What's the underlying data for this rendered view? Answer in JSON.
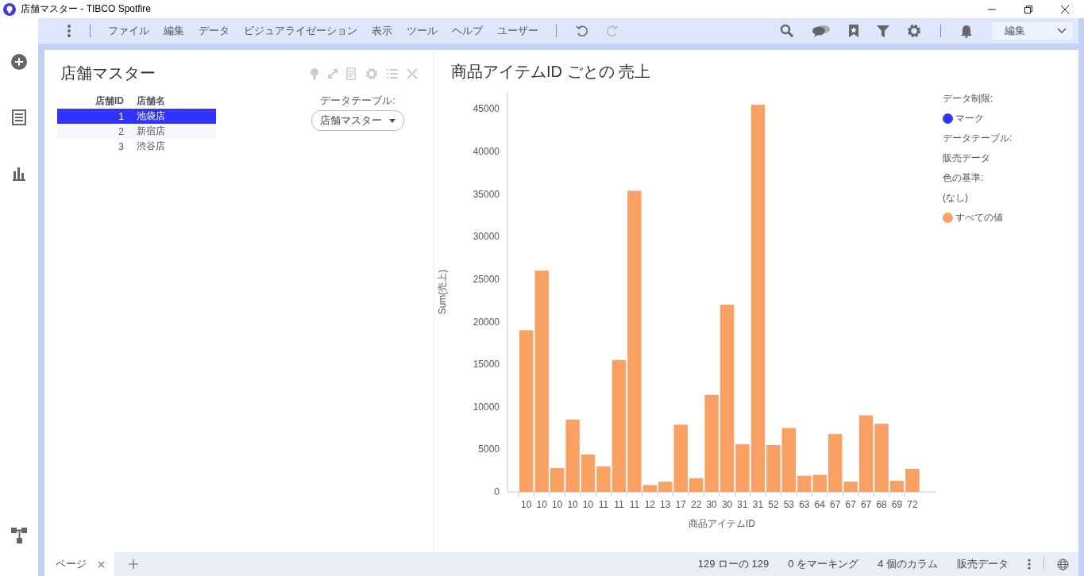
{
  "window": {
    "title": "店舗マスター - TIBCO Spotfire"
  },
  "menu": [
    "ファイル",
    "編集",
    "データ",
    "ビジュアライゼーション",
    "表示",
    "ツール",
    "ヘルプ",
    "ユーザー"
  ],
  "mode_dropdown": {
    "value": "編集"
  },
  "table_panel": {
    "title": "店舗マスター",
    "columns": [
      "店舗ID",
      "店舗名"
    ],
    "rows": [
      {
        "cells": [
          "1",
          "池袋店"
        ],
        "selected": true
      },
      {
        "cells": [
          "2",
          "新宿店"
        ],
        "selected": false
      },
      {
        "cells": [
          "3",
          "渋谷店"
        ],
        "selected": false
      }
    ],
    "data_table_label": "データテーブル:",
    "data_table_value": "店舗マスター"
  },
  "chart_panel": {
    "title": "商品アイテムID ごとの 売上",
    "chart_data": {
      "type": "bar",
      "xlabel": "商品アイテムID",
      "ylabel": "Sum(売上)",
      "categories": [
        "10",
        "10",
        "10",
        "10",
        "10",
        "11",
        "11",
        "11",
        "12",
        "13",
        "17",
        "22",
        "30",
        "30",
        "31",
        "31",
        "52",
        "53",
        "63",
        "64",
        "67",
        "67",
        "67",
        "68",
        "69",
        "72"
      ],
      "series": [
        {
          "name": "すべての値",
          "color": "#f9a062",
          "values": [
            19000,
            26000,
            2800,
            8500,
            4400,
            3000,
            15500,
            35400,
            800,
            1200,
            7900,
            1600,
            11400,
            22000,
            5600,
            45500,
            5500,
            7500,
            1900,
            2000,
            6800,
            1200,
            9000,
            8000,
            1300,
            2700
          ]
        }
      ],
      "ylim": [
        0,
        47000
      ],
      "yticks": [
        0,
        5000,
        10000,
        15000,
        20000,
        25000,
        30000,
        35000,
        40000,
        45000
      ]
    },
    "legend": [
      {
        "kind": "heading",
        "text": "データ制限:"
      },
      {
        "kind": "swatch",
        "text": "マーク",
        "color": "#3333ff"
      },
      {
        "kind": "heading",
        "text": "データテーブル:"
      },
      {
        "kind": "value",
        "text": "販売データ"
      },
      {
        "kind": "heading",
        "text": "色の基準:"
      },
      {
        "kind": "value",
        "text": "(なし)"
      }
    ]
  },
  "page_tab": {
    "label": "ページ"
  },
  "status_bar": [
    "129 ローの 129",
    "0 をマーキング",
    "4 個のカラム",
    "販売データ"
  ]
}
